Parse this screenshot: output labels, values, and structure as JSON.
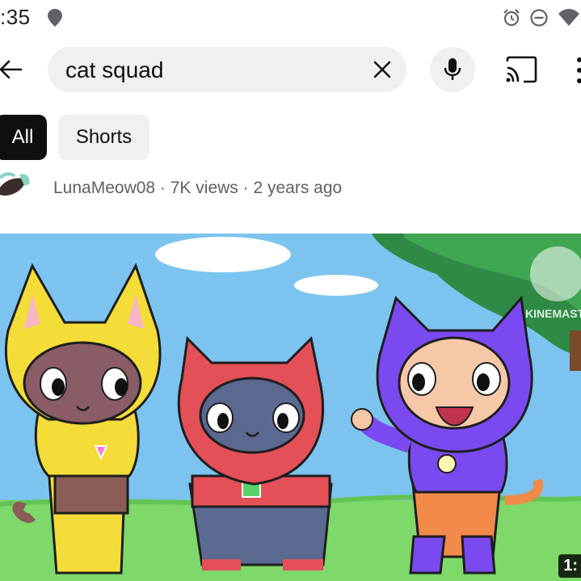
{
  "status_bar": {
    "time": ":35",
    "icons": [
      "location-pin-icon",
      "alarm-icon",
      "do-not-disturb-icon",
      "wifi-icon"
    ]
  },
  "search_bar": {
    "query": "cat squad",
    "icons": [
      "back-arrow-icon",
      "clear-icon",
      "microphone-icon",
      "cast-icon",
      "more-vert-icon"
    ]
  },
  "chips": [
    {
      "label": "All",
      "selected": true
    },
    {
      "label": "Shorts",
      "selected": false
    }
  ],
  "result": {
    "channel": "LunaMeow08",
    "meta": "LunaMeow08 · 7K views · 2 years ago",
    "duration": "1:",
    "watermark": "KINEMASTER"
  },
  "colors": {
    "chip_selected_bg": "#0f0f0f",
    "chip_bg": "#f0f0f0",
    "meta_text": "#606060",
    "sky": "#7cc4ef",
    "grass": "#7ed86a"
  }
}
